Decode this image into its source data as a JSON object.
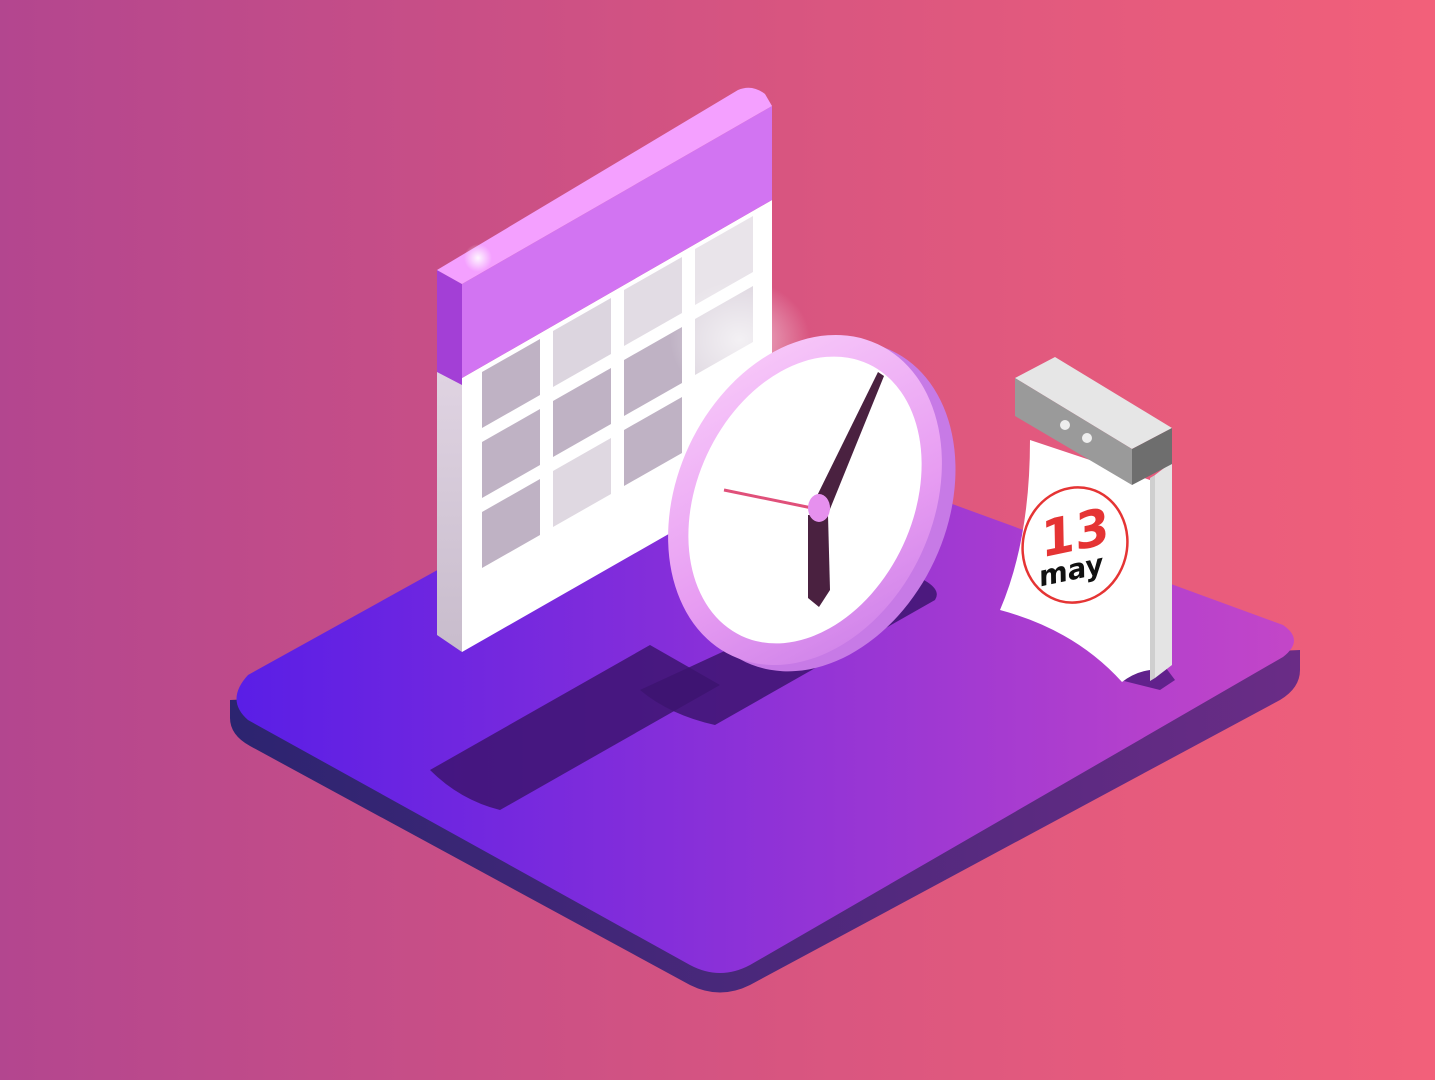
{
  "scene": {
    "description_label": "",
    "colors": {
      "background_left": "#b3468f",
      "background_right": "#f2607a",
      "platform_left": "#5a1ee6",
      "platform_right": "#c346c8",
      "platform_edge": "#3a2680",
      "calendar_header": "#d274f2",
      "calendar_header_edge": "#a33fd6",
      "calendar_body": "#ffffff",
      "calendar_cell": "#bfb2c4",
      "clock_rim": "#f4a6f7",
      "clock_face": "#ffffff",
      "clock_hand": "#4a2140",
      "second_hand": "#e0507a",
      "tearoff_binding": "#9a9a9a",
      "date_number": "#e53434",
      "date_month": "#111111",
      "date_circle": "#e53434"
    },
    "icons": [
      "wall-calendar-icon",
      "clock-icon",
      "tear-off-calendar-icon"
    ],
    "tearoff_calendar": {
      "day": "13",
      "month": "may"
    }
  }
}
